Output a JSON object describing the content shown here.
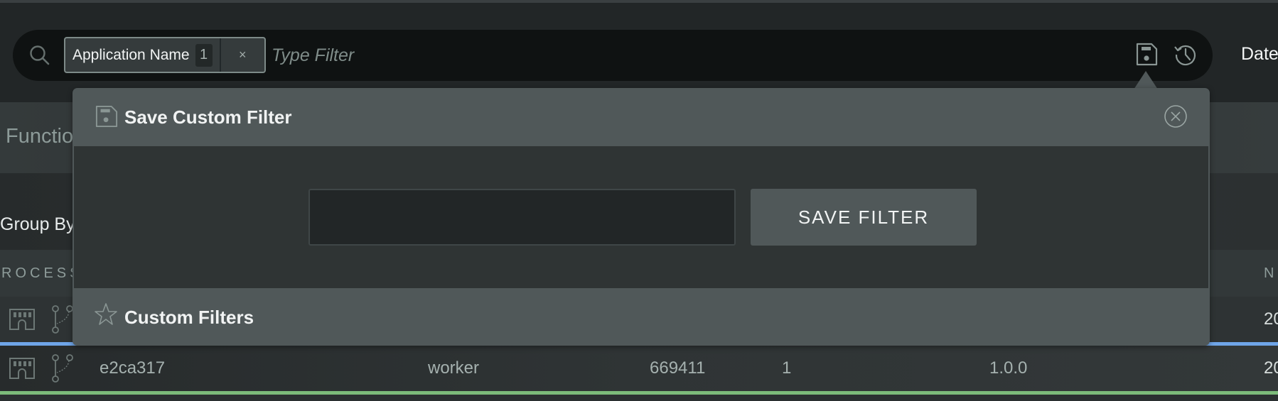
{
  "search": {
    "chip": {
      "label": "Application Name",
      "count": "1",
      "remove": "×"
    },
    "placeholder": "Type Filter",
    "value": ""
  },
  "header": {
    "date_label": "Date"
  },
  "tabs": {
    "functions_label": "Functio"
  },
  "toolbar": {
    "group_by_label": "Group By"
  },
  "table": {
    "columns": {
      "process": "ROCESS",
      "n": "N"
    },
    "rows": [
      {
        "id": "",
        "name": "",
        "pid": "",
        "count": "",
        "version": "",
        "date": "20",
        "status_color": "#6fa5e8"
      },
      {
        "id": "e2ca317",
        "name": "worker",
        "pid": "669411",
        "count": "1",
        "version": "1.0.0",
        "date": "20",
        "status_color": "#7cbb7a"
      }
    ]
  },
  "popover": {
    "title": "Save Custom Filter",
    "input_value": "",
    "save_button": "SAVE FILTER",
    "custom_filters_title": "Custom Filters"
  }
}
